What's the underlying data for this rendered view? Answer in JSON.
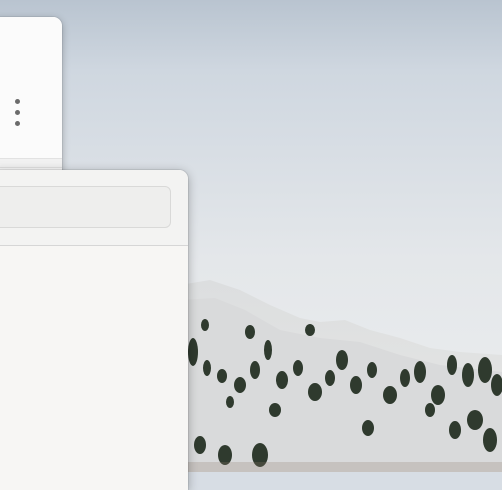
{
  "desktop": {
    "wallpaper": "snowy-mountain-slope"
  },
  "back_window": {
    "menu_icon": "vertical-ellipsis-icon"
  },
  "front_window": {
    "search": {
      "value": "",
      "placeholder": ""
    }
  }
}
